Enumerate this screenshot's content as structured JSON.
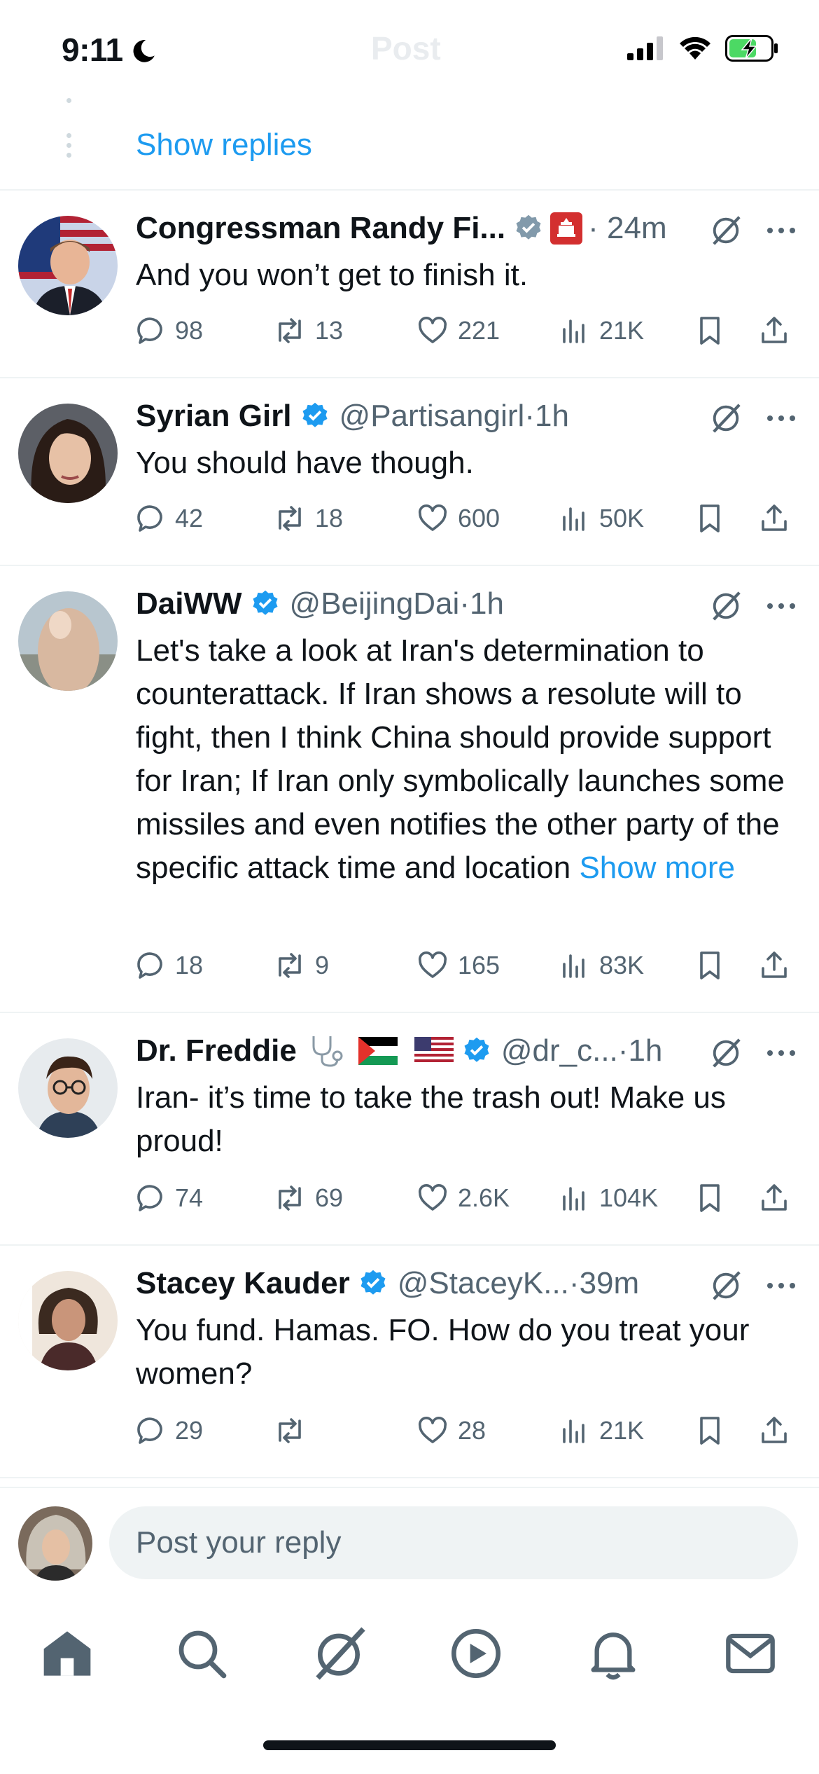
{
  "status_bar": {
    "time": "9:11",
    "ghost_title": "Post"
  },
  "thread": {
    "show_replies_label": "Show replies"
  },
  "replies": [
    {
      "display_name": "Congressman Randy Fi...",
      "handle": "",
      "time": "24m",
      "verified": "gray",
      "extra_badge": "capitol-badge",
      "text": "And you won’t get to finish it.",
      "show_more": "",
      "stats": {
        "replies": "98",
        "reposts": "13",
        "likes": "221",
        "views": "21K"
      }
    },
    {
      "display_name": "Syrian Girl",
      "handle": "@Partisangirl",
      "time": "1h",
      "verified": "blue",
      "text": "You should have though.",
      "show_more": "",
      "stats": {
        "replies": "42",
        "reposts": "18",
        "likes": "600",
        "views": "50K"
      }
    },
    {
      "display_name": "DaiWW",
      "handle": "@BeijingDai",
      "time": "1h",
      "verified": "blue",
      "text": "Let's take a look at Iran's determination to counterattack. If Iran shows a resolute will to fight, then I think China should provide support for Iran; If Iran only symbolically launches some missiles and even notifies the other party of the specific attack time and location",
      "show_more": "Show more",
      "stats": {
        "replies": "18",
        "reposts": "9",
        "likes": "165",
        "views": "83K"
      }
    },
    {
      "display_name": "Dr. Freddie",
      "handle": "@dr_c...",
      "time": "1h",
      "verified": "blue",
      "name_emoji": [
        "stethoscope-emoji",
        "palestine-flag-emoji",
        "us-flag-emoji"
      ],
      "text": "Iran- it’s time to take the trash out! Make us proud!",
      "show_more": "",
      "stats": {
        "replies": "74",
        "reposts": "69",
        "likes": "2.6K",
        "views": "104K"
      }
    },
    {
      "display_name": "Stacey Kauder",
      "handle": "@StaceyK...",
      "time": "39m",
      "verified": "blue",
      "text": "You fund. Hamas. FO. How do you treat your women?",
      "show_more": "",
      "stats": {
        "replies": "29",
        "reposts": "",
        "likes": "28",
        "views": "21K"
      }
    }
  ],
  "composer": {
    "placeholder": "Post your reply"
  },
  "tabs": [
    "home-icon",
    "search-icon",
    "grok-icon",
    "video-icon",
    "notifications-icon",
    "messages-icon"
  ],
  "colors": {
    "accent": "#1d9bf0",
    "text_primary": "#0f1419",
    "text_secondary": "#536471",
    "divider": "#eff3f4",
    "gray_badge": "#829aab",
    "battery_green": "#4cd964"
  }
}
